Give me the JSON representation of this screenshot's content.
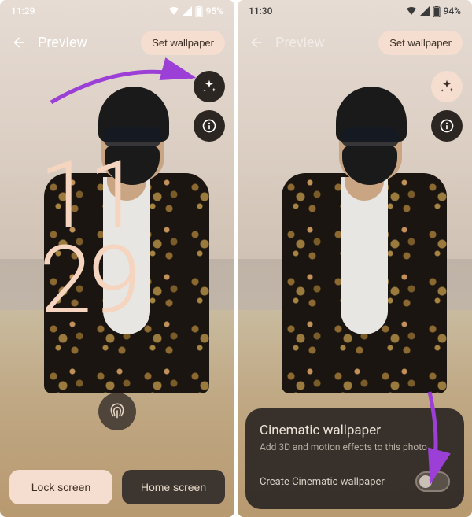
{
  "left": {
    "status": {
      "time": "11:29",
      "battery": "95%"
    },
    "header": {
      "title": "Preview",
      "set_wallpaper": "Set wallpaper"
    },
    "clock": {
      "hours": "11",
      "minutes": "29"
    },
    "buttons": {
      "lock_screen": "Lock screen",
      "home_screen": "Home screen"
    }
  },
  "right": {
    "status": {
      "time": "11:30",
      "battery": "94%"
    },
    "header": {
      "title": "Preview",
      "set_wallpaper": "Set wallpaper"
    },
    "sheet": {
      "title": "Cinematic wallpaper",
      "subtitle": "Add 3D and motion effects to this photo",
      "toggle_label": "Create Cinematic wallpaper"
    }
  },
  "icons": {
    "sparkle": "sparkle-icon",
    "info": "info-icon",
    "back": "back-arrow-icon",
    "fingerprint": "fingerprint-icon",
    "wifi": "wifi-icon",
    "signal": "signal-icon",
    "battery": "battery-icon"
  },
  "colors": {
    "accent": "#f5ddd0",
    "dark": "#2b2622",
    "arrow": "#9b3fd6"
  }
}
